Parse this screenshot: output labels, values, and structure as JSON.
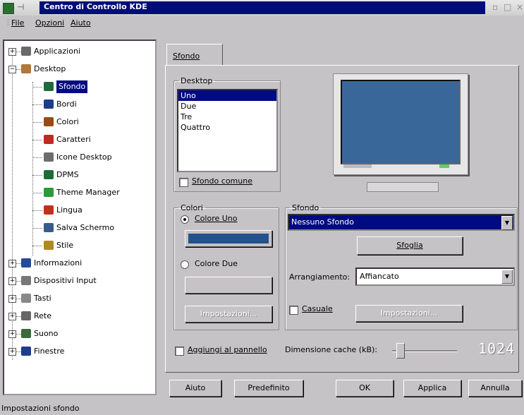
{
  "window": {
    "title": "Centro di Controllo KDE",
    "buttons": [
      "▫",
      "□",
      "×"
    ]
  },
  "menu": [
    {
      "label": "File"
    },
    {
      "label": "Opzioni"
    },
    {
      "label": "Aiuto"
    }
  ],
  "tree": {
    "items": [
      {
        "label": "Applicazioni",
        "icon": "applications-icon",
        "color": "#6a6a6a"
      },
      {
        "label": "Desktop",
        "icon": "desktop-icon",
        "color": "#b0783a"
      },
      {
        "label": "Sfondo",
        "icon": "background-icon",
        "color": "#1d6b3a",
        "selected": true
      },
      {
        "label": "Bordi",
        "icon": "borders-icon",
        "color": "#1c3d8a"
      },
      {
        "label": "Colori",
        "icon": "colors-icon",
        "color": "#9a4a16"
      },
      {
        "label": "Caratteri",
        "icon": "fonts-icon",
        "color": "#c02a20"
      },
      {
        "label": "Icone Desktop",
        "icon": "desktop-icons-icon",
        "color": "#6d6d6d"
      },
      {
        "label": "DPMS",
        "icon": "dpms-icon",
        "color": "#1d6b3a"
      },
      {
        "label": "Theme Manager",
        "icon": "theme-manager-icon",
        "color": "#2a9a3a"
      },
      {
        "label": "Lingua",
        "icon": "language-icon",
        "color": "#c03020"
      },
      {
        "label": "Salva Schermo",
        "icon": "screensaver-icon",
        "color": "#355b8a"
      },
      {
        "label": "Stile",
        "icon": "style-icon",
        "color": "#b08a20"
      },
      {
        "label": "Informazioni",
        "icon": "information-icon",
        "color": "#244a9a"
      },
      {
        "label": "Dispositivi Input",
        "icon": "input-devices-icon",
        "color": "#777777"
      },
      {
        "label": "Tasti",
        "icon": "keys-icon",
        "color": "#888888"
      },
      {
        "label": "Rete",
        "icon": "network-icon",
        "color": "#666666"
      },
      {
        "label": "Suono",
        "icon": "sound-icon",
        "color": "#3a6a3a"
      },
      {
        "label": "Finestre",
        "icon": "windows-icon",
        "color": "#1c3d8a"
      }
    ]
  },
  "tab": {
    "label": "Sfondo"
  },
  "desktop_group": {
    "label": "Desktop",
    "items": [
      "Uno",
      "Due",
      "Tre",
      "Quattro"
    ],
    "selected": "Uno",
    "common_label": "Sfondo comune"
  },
  "colors_group": {
    "label": "Colori",
    "color_one_label": "Colore Uno",
    "color_two_label": "Colore Due",
    "color_one_value": "#24528c",
    "settings_label": "Impostazioni..."
  },
  "background_group": {
    "label": "Sfondo",
    "wallpaper_value": "Nessuno Sfondo",
    "browse_label": "Sfoglia",
    "arrangement_label": "Arrangiamento:",
    "arrangement_value": "Affiancato",
    "random_label": "Casuale",
    "settings_label": "Impostazioni..."
  },
  "preview": {
    "screen_color": "#3a679a"
  },
  "dock_label": "Aggiungi al pannello",
  "cache": {
    "label": "Dimensione cache (kB):",
    "value": "1024",
    "slider_fraction": 0.12
  },
  "buttons": {
    "help": "Aiuto",
    "default": "Predefinito",
    "ok": "OK",
    "apply": "Applica",
    "cancel": "Annulla"
  },
  "status": "Impostazioni sfondo"
}
